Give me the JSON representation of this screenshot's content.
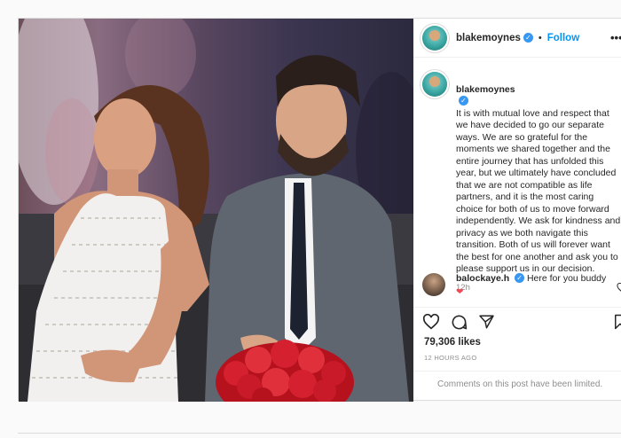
{
  "post": {
    "username": "blakemoynes",
    "follow_label": "Follow",
    "dot": "•",
    "more_label": "•••",
    "verified_mark": "✓",
    "caption": "It is with mutual love and respect that we have decided to go our separate ways. We are so grateful for the moments we shared together and the entire journey that has unfolded this year, but we ultimately have concluded that we are not compatible as life partners, and it is the most caring choice for both of us to move forward independently. We ask for kindness and privacy as we both navigate this transition. Both of us will forever want the best for one another and ask you to please support us in our decision.",
    "caption_time": "12h",
    "likes": "79,306 likes",
    "posted_ago": "12 HOURS AGO",
    "limited_notice": "Comments on this post have been limited."
  },
  "reply": {
    "username": "balockaye.h",
    "text": "Here for you buddy",
    "heart": "❤"
  },
  "icons": {
    "like": "heart-icon",
    "comment": "comment-icon",
    "share": "share-icon",
    "save": "bookmark-icon"
  },
  "colors": {
    "accent": "#0095f6",
    "verified": "#3897f0",
    "heart": "#ed4956",
    "muted": "#8e8e8e",
    "roses": "#d4202f"
  }
}
